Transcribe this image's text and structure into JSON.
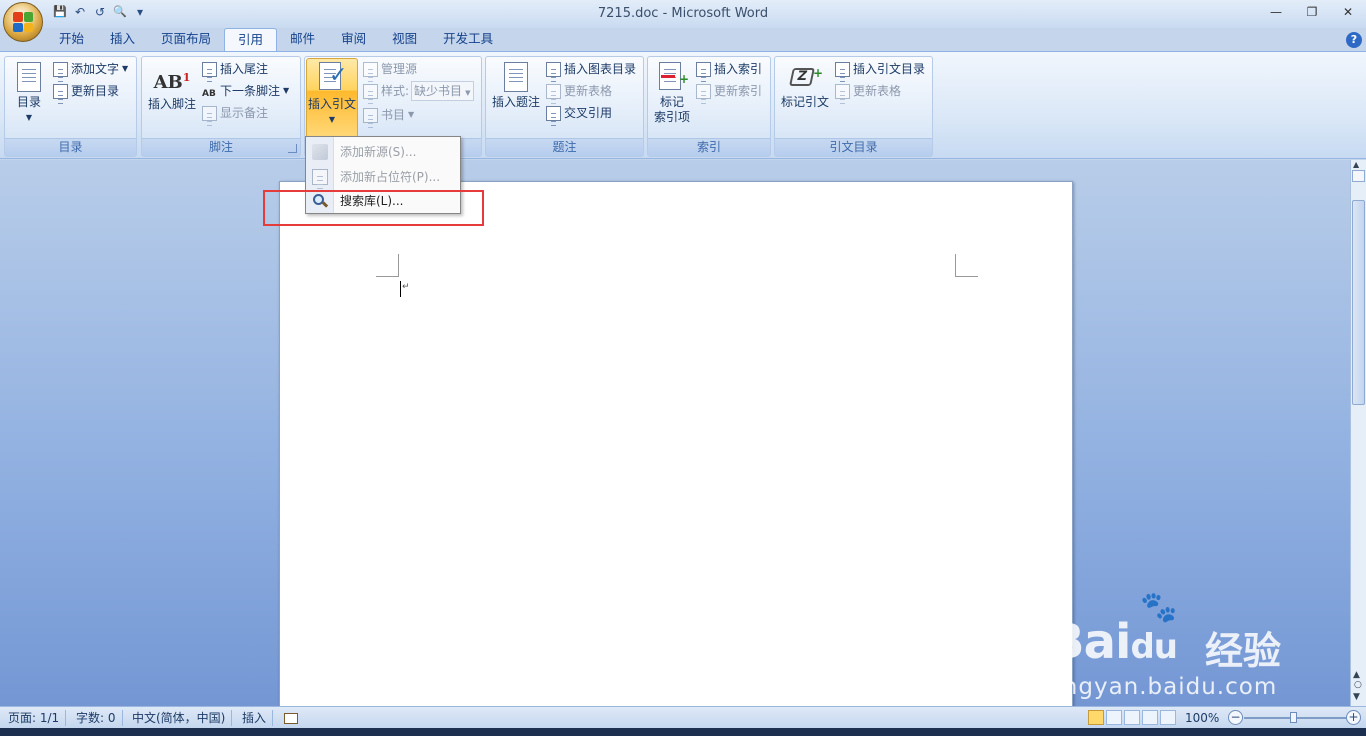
{
  "window": {
    "title": "7215.doc - Microsoft Word",
    "minimize": "—",
    "restore": "❐",
    "close": "✕"
  },
  "qat": {
    "save": "💾",
    "undo": "↶",
    "redo": "↺",
    "print_preview": "🔍",
    "customize": "▾"
  },
  "tabs": [
    "开始",
    "插入",
    "页面布局",
    "引用",
    "邮件",
    "审阅",
    "视图",
    "开发工具"
  ],
  "help": "?",
  "ribbon": {
    "toc": {
      "label": "目录",
      "big": "目录",
      "add_text": "添加文字",
      "update": "更新目录"
    },
    "footnote": {
      "label": "脚注",
      "insert_footnote": "插入脚注",
      "insert_endnote": "插入尾注",
      "next_footnote": "下一条脚注",
      "show_notes": "显示备注",
      "ab_glyph": "AB",
      "ab_sup": "1"
    },
    "citation": {
      "insert_citation": "插入引文",
      "manage_sources": "管理源",
      "style_label": "样式:",
      "style_value": "缺少书目",
      "bibliography": "书目"
    },
    "caption": {
      "label": "题注",
      "insert_caption": "插入题注",
      "insert_tof": "插入图表目录",
      "update_table": "更新表格",
      "cross_ref": "交叉引用"
    },
    "index": {
      "label": "索引",
      "mark_entry_1": "标记",
      "mark_entry_2": "索引项",
      "insert_index": "插入索引",
      "update_index": "更新索引"
    },
    "toa": {
      "label": "引文目录",
      "mark_citation": "标记引文",
      "insert_toa": "插入引文目录",
      "update_table": "更新表格"
    }
  },
  "menu": {
    "items": [
      {
        "label": "添加新源(S)...",
        "enabled": false
      },
      {
        "label": "添加新占位符(P)...",
        "enabled": false
      },
      {
        "label": "搜索库(L)...",
        "enabled": true
      }
    ]
  },
  "status": {
    "page": "页面: 1/1",
    "words": "字数: 0",
    "lang": "中文(简体，中国)",
    "mode": "插入",
    "zoom": "100%",
    "zoom_level_percent": 100
  },
  "watermark": {
    "brand": "Bai",
    "brand2": "du",
    "cn": "经验",
    "url": "jingyan.baidu.com"
  }
}
